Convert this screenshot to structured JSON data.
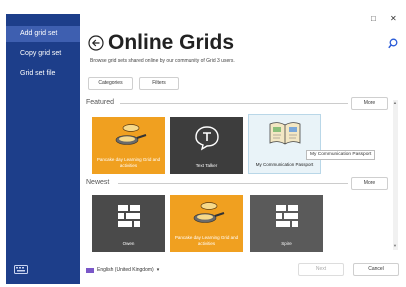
{
  "window": {
    "maximize_glyph": "□",
    "close_glyph": "✕"
  },
  "sidebar": {
    "items": [
      {
        "label": "Add grid set",
        "active": true
      },
      {
        "label": "Copy grid set",
        "active": false
      },
      {
        "label": "Grid set file",
        "active": false
      }
    ],
    "keyboard_icon": "keyboard-icon"
  },
  "header": {
    "title": "Online Grids",
    "subtitle": "Browse grid sets shared online by our community of Grid 3 users.",
    "back_icon": "back-arrow-icon",
    "search_icon": "search-icon"
  },
  "filters": {
    "categories_label": "Categories",
    "filters_label": "Filters"
  },
  "featured": {
    "label": "Featured",
    "more_label": "More",
    "tiles": [
      {
        "label": "Pancake day Learning Grid and activities",
        "color": "#f0a020",
        "icon": "frying-pan-icon"
      },
      {
        "label": "Text Talker",
        "color": "#3d3d3d",
        "icon": "speech-bubble-t-icon"
      },
      {
        "label": "My Communication Passport",
        "color": "#e9f3f8",
        "icon": "open-book-icon"
      }
    ],
    "tooltip": "My Communication Passport"
  },
  "newest": {
    "label": "Newest",
    "more_label": "More",
    "tiles": [
      {
        "label": "Owen",
        "color": "#4a4a4a",
        "icon": "grid-blocks-icon"
      },
      {
        "label": "Pancake day Learning Grid and activities",
        "color": "#f0a020",
        "icon": "frying-pan-icon"
      },
      {
        "label": "Spire",
        "color": "#5a5a5a",
        "icon": "grid-blocks-icon"
      }
    ]
  },
  "footer": {
    "language": "English (United Kingdom)",
    "next_label": "Next",
    "cancel_label": "Cancel"
  },
  "colors": {
    "sidebar": "#1d3e8a",
    "sidebar_active": "#3e5fb0",
    "accent_blue": "#2a5bd7",
    "orange": "#f0a020"
  }
}
